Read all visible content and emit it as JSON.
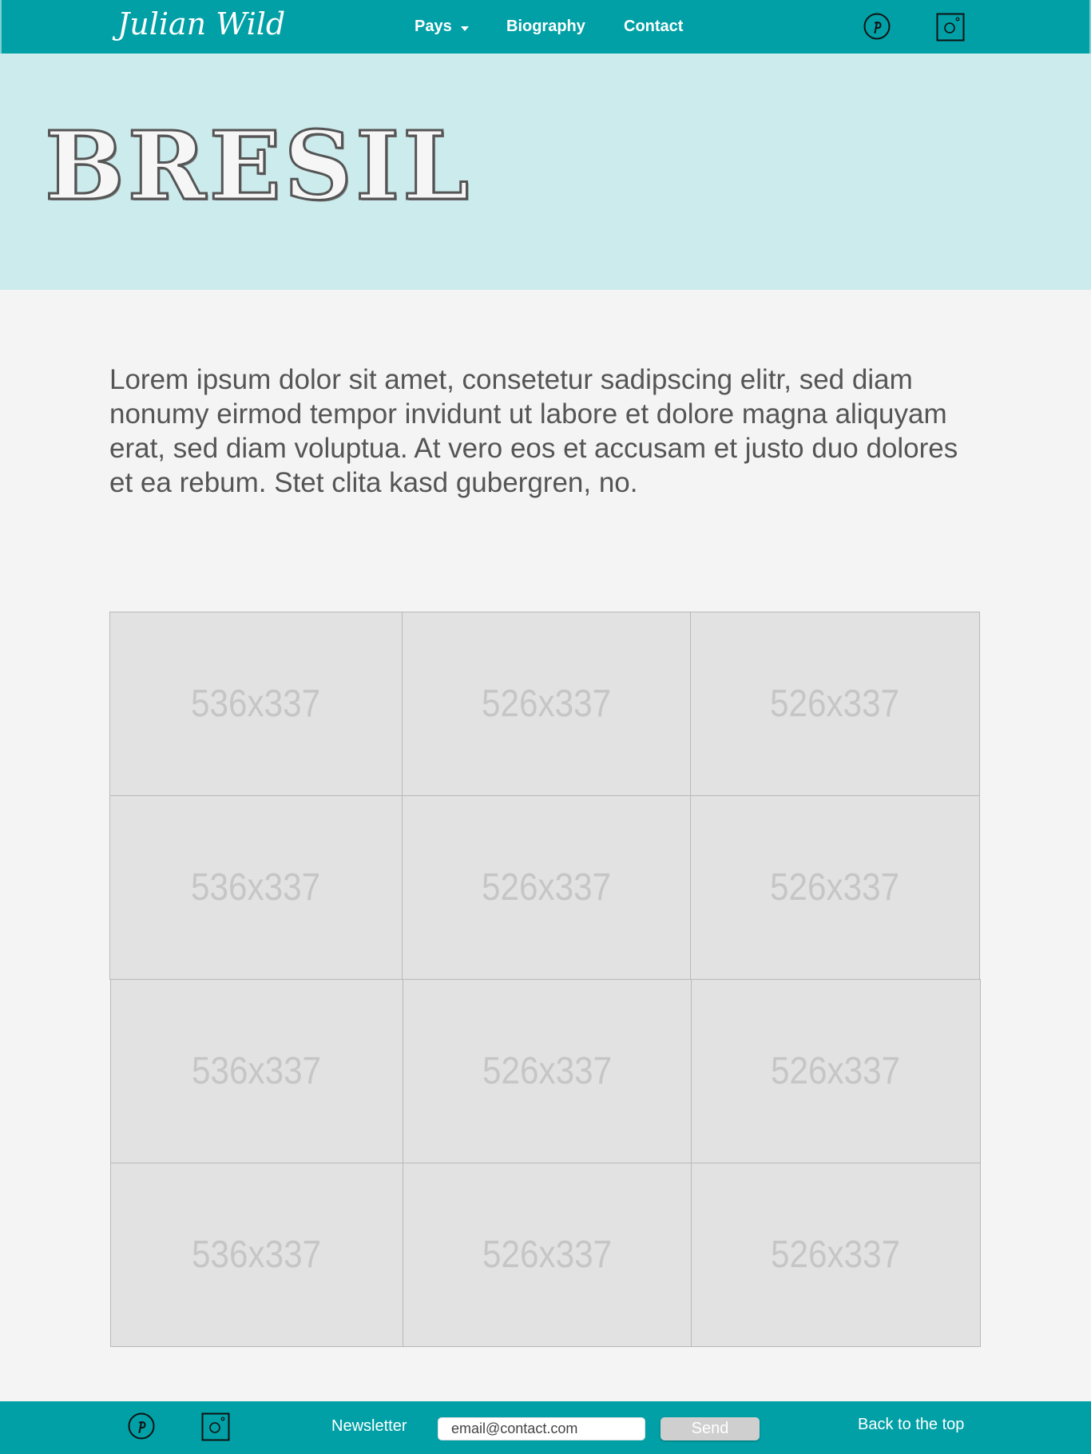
{
  "header": {
    "logo": "Julian Wild",
    "nav": [
      {
        "label": "Pays",
        "has_dropdown": true
      },
      {
        "label": "Biography"
      },
      {
        "label": "Contact"
      }
    ],
    "social_icons": [
      "pinterest-icon",
      "instagram-icon"
    ]
  },
  "hero": {
    "title": "BRESIL"
  },
  "intro": {
    "text": "Lorem ipsum dolor sit amet, consetetur sadipscing elitr, sed diam nonumy eirmod tempor invidunt ut labore et dolore magna aliquyam erat, sed diam voluptua. At vero eos et accusam et justo duo dolores et ea rebum. Stet clita kasd gubergren, no."
  },
  "gallery": {
    "rows": [
      [
        "536x337",
        "526x337",
        "526x337"
      ],
      [
        "536x337",
        "526x337",
        "526x337"
      ],
      [
        "536x337",
        "526x337",
        "526x337"
      ],
      [
        "536x337",
        "526x337",
        "526x337"
      ]
    ]
  },
  "footer": {
    "newsletter_label": "Newsletter",
    "email_value": "email@contact.com",
    "send_label": "Send",
    "back_to_top": "Back to the top",
    "social_icons": [
      "pinterest-icon",
      "instagram-icon"
    ]
  },
  "colors": {
    "brand_teal": "#00a0a6",
    "hero_bg": "#ccebec",
    "page_bg": "#f4f4f4",
    "placeholder_bg": "#e2e2e2"
  }
}
